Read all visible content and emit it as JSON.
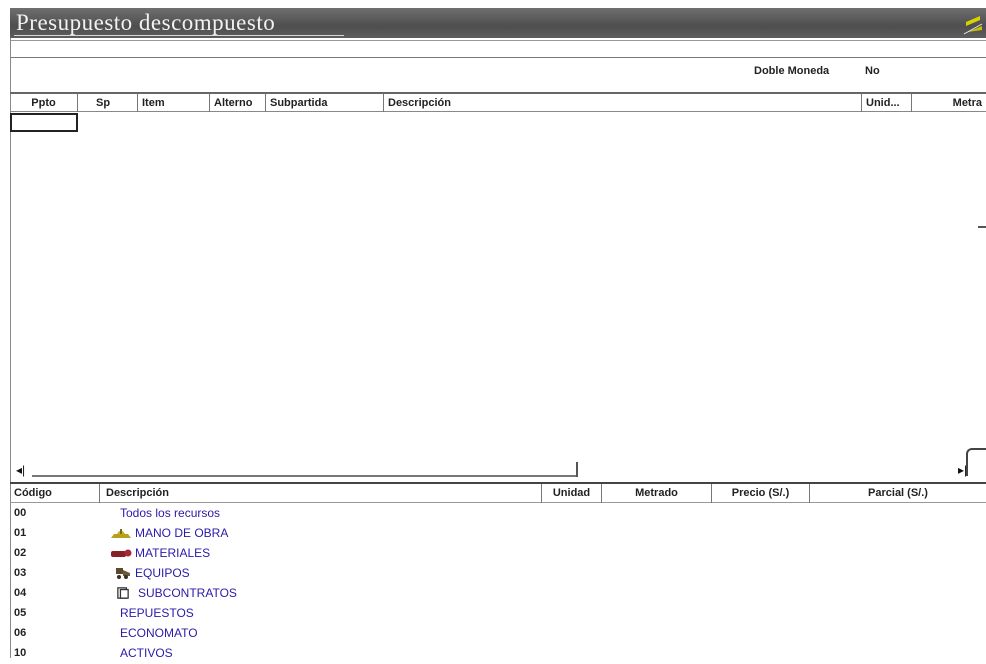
{
  "window": {
    "title": "Presupuesto descompuesto"
  },
  "toolbar": {
    "doble_moneda_label": "Doble Moneda",
    "doble_moneda_value": "No"
  },
  "grid": {
    "columns": [
      "Ppto",
      "Sp",
      "Item",
      "Alterno",
      "Subpartida",
      "Descripción",
      "Unid...",
      "Metra"
    ]
  },
  "resources": {
    "columns": [
      "Código",
      "Descripción",
      "Unidad",
      "Metrado",
      "Precio (S/.)",
      "Parcial (S/.)"
    ],
    "rows": [
      {
        "code": "00",
        "description": "Todos los recursos",
        "icon": ""
      },
      {
        "code": "01",
        "description": "MANO DE OBRA",
        "icon": "workers-icon"
      },
      {
        "code": "02",
        "description": "MATERIALES",
        "icon": "pipe-icon"
      },
      {
        "code": "03",
        "description": "EQUIPOS",
        "icon": "machine-icon"
      },
      {
        "code": "04",
        "description": "SUBCONTRATOS",
        "icon": "document-icon"
      },
      {
        "code": "05",
        "description": "REPUESTOS",
        "icon": ""
      },
      {
        "code": "06",
        "description": "ECONOMATO",
        "icon": ""
      },
      {
        "code": "10",
        "description": "ACTIVOS",
        "icon": ""
      }
    ]
  },
  "colors": {
    "title_bar": "#5a5a5a",
    "resource_text": "#2a1aa8",
    "icon_mano": "#b8a01c",
    "icon_mat": "#8a1f2a",
    "icon_eq": "#5a4a2e"
  }
}
